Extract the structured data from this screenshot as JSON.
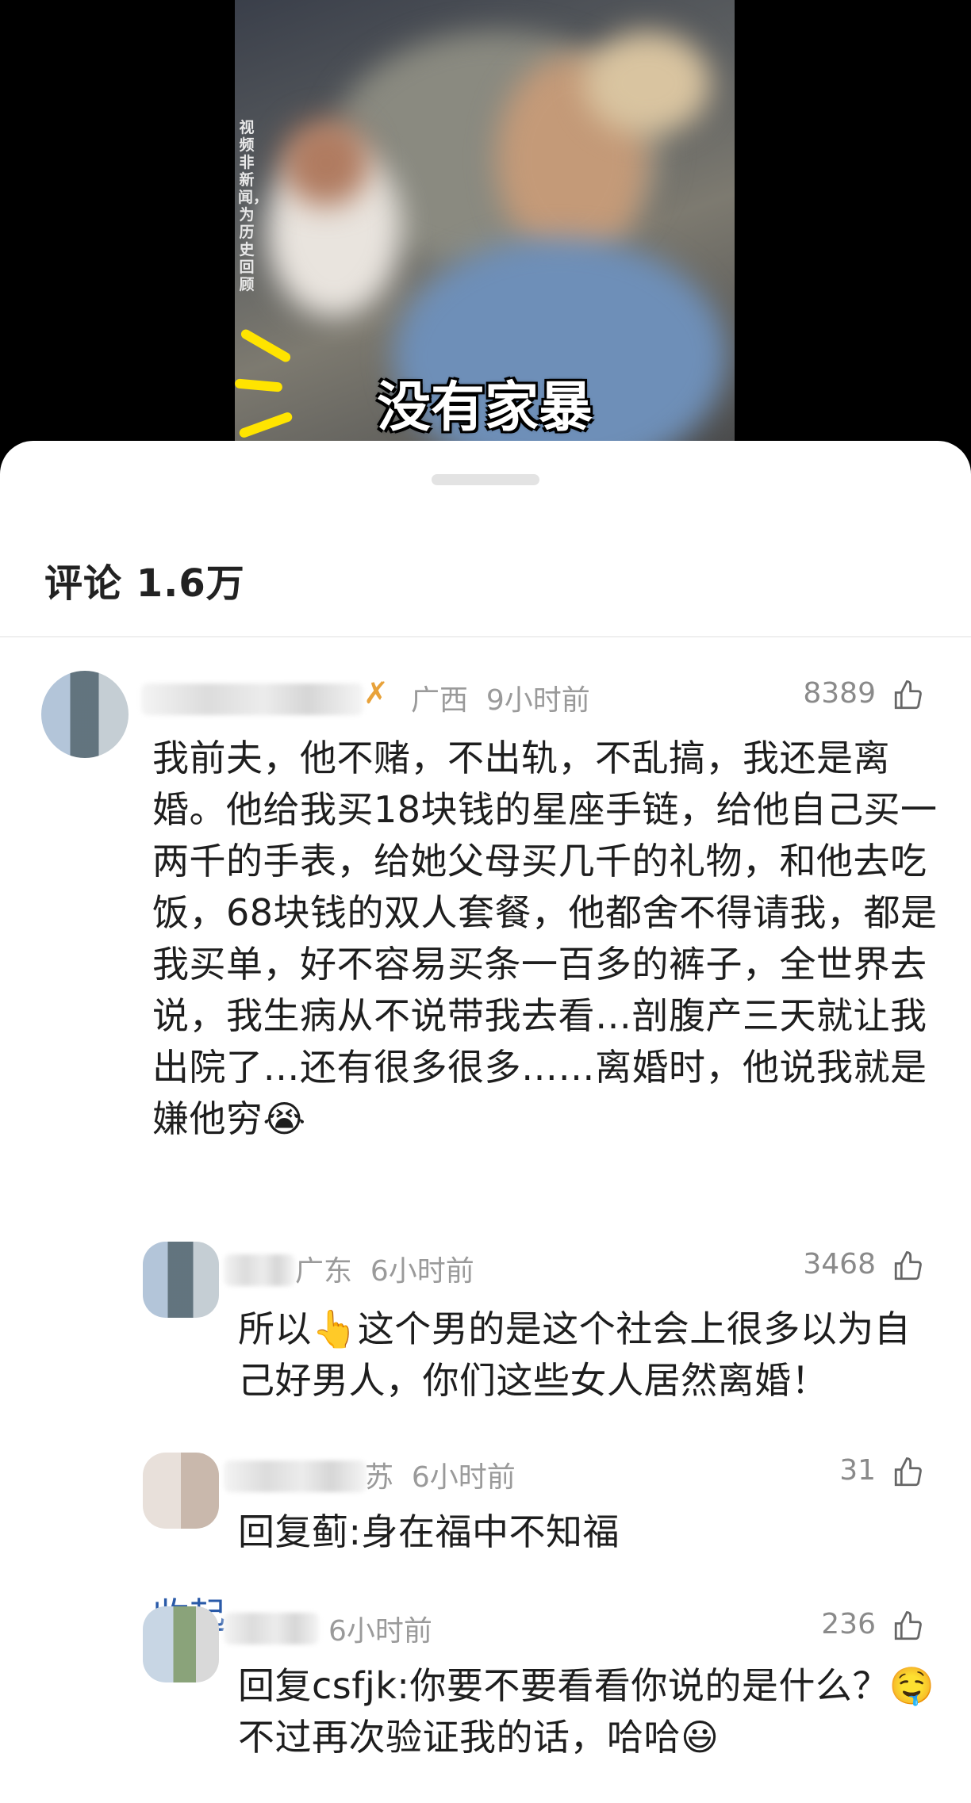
{
  "video": {
    "side_note": "视频非新闻，为历史回顾",
    "caption": "没有家暴"
  },
  "comments_sheet": {
    "title": "评论 1.6万",
    "accent_color": "#2a5aa8"
  },
  "comments": [
    {
      "location": "广西",
      "time": "9小时前",
      "likes": "8389",
      "text": "我前夫，他不赌，不出轨，不乱搞，我还是离婚。他给我买18块钱的星座手链，给他自己买一两千的手表，给她父母买几千的礼物，和他去吃饭，68块钱的双人套餐，他都舍不得请我，都是我买单，好不容易买条一百多的裤子，全世界去说，我生病从不说带我去看…剖腹产三天就让我出院了…还有很多很多……离婚时，他说我就是嫌他穷😭",
      "collapse_label": "收起"
    },
    {
      "location": "广东",
      "time": "6小时前",
      "likes": "3468",
      "text": "所以👆这个男的是这个社会上很多以为自己好男人，你们这些女人居然离婚！"
    },
    {
      "location": "苏",
      "time": "6小时前",
      "likes": "31",
      "text": "回复蓟:身在福中不知福"
    },
    {
      "location": "",
      "time": "6小时前",
      "likes": "236",
      "text": "回复csfjk:你要不要看看你说的是什么？🤤不过再次验证我的话，哈哈😃"
    }
  ]
}
